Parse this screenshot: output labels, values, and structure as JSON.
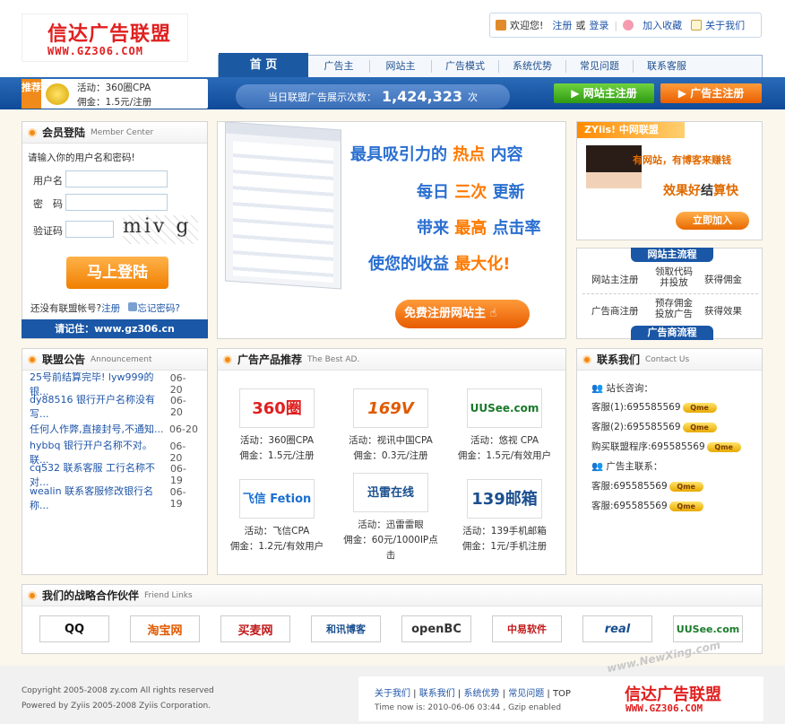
{
  "logo": {
    "cn": "信达广告联盟",
    "url": "WWW.GZ306.COM"
  },
  "toplinks": {
    "welcome": "欢迎您!",
    "register": "注册",
    "or": "或",
    "login": "登录",
    "favorite": "加入收藏",
    "about": "关于我们"
  },
  "nav": [
    "首 页",
    "广告主",
    "网站主",
    "广告模式",
    "系统优势",
    "常见问题",
    "联系客服"
  ],
  "tuijian": {
    "tag": "推荐",
    "activity": "活动：360圈CPA",
    "commission": "佣金：1.5元/注册"
  },
  "counter": {
    "label": "当日联盟广告展示次数：",
    "value": "1,424,323",
    "unit": "次"
  },
  "buttons": {
    "webmaster_register": "网站主注册",
    "advertiser_register": "广告主注册"
  },
  "login": {
    "title": "会员登陆",
    "en": "Member Center",
    "prompt": "请输入你的用户名和密码!",
    "username": "用户名",
    "password": "密　码",
    "captcha": "验证码",
    "captcha_img": "miv g",
    "submit": "马上登陆",
    "no_account": "还没有联盟帐号?",
    "register": "注册",
    "forgot": "忘记密码?",
    "remember": "请记住：www.gz306.cn"
  },
  "banner": {
    "line1a": "最具吸引力的",
    "line1b": "热点",
    "line1c": "内容",
    "line2a": "每日",
    "line2b": "三次",
    "line2c": "更新",
    "line3a": "带来",
    "line3b": "最高",
    "line3c": "点击率",
    "line4a": "使您的收益",
    "line4b": "最大化!",
    "cta": "免费注册网站主"
  },
  "zyiis": {
    "brand": "ZYiis! 中网联盟",
    "slogan1": "有网站，有博客来赚钱",
    "slogan2a": "效果好",
    "slogan2b": "结",
    "slogan2c": "算快",
    "join": "立即加入"
  },
  "flow": {
    "title1": "网站主流程",
    "w1": "网站主注册",
    "w2": "领取代码并投放",
    "w3": "获得佣金",
    "a1": "广告商注册",
    "a2": "预存佣金投放广告",
    "a3": "获得效果",
    "title2": "广告商流程"
  },
  "announce": {
    "title": "联盟公告",
    "en": "Announcement",
    "items": [
      {
        "text": "25号前结算完毕! lyw999的银...",
        "date": "06-20"
      },
      {
        "text": "dy88516 银行开户名称没有写...",
        "date": "06-20"
      },
      {
        "text": "任何人作弊,直接封号,不通知...",
        "date": "06-20"
      },
      {
        "text": "hybbq 银行开户名称不对。联...",
        "date": "06-20"
      },
      {
        "text": "cq532 联系客服 工行名称不对...",
        "date": "06-19"
      },
      {
        "text": "wealin 联系客服修改银行名称...",
        "date": "06-19"
      }
    ]
  },
  "products": {
    "title": "广告产品推荐",
    "en": "The Best AD.",
    "items": [
      {
        "logo": "360圈",
        "act": "活动：360圈CPA",
        "pay": "佣金：1.5元/注册"
      },
      {
        "logo": "169V",
        "act": "活动：视讯中国CPA",
        "pay": "佣金：0.3元/注册"
      },
      {
        "logo": "UUSee.com",
        "act": "活动：悠视 CPA",
        "pay": "佣金：1.5元/有效用户"
      },
      {
        "logo": "飞信 Fetion",
        "act": "活动：飞信CPA",
        "pay": "佣金：1.2元/有效用户"
      },
      {
        "logo": "迅雷在线",
        "act": "活动：迅雷雷眼",
        "pay": "佣金：60元/1000IP点击"
      },
      {
        "logo": "139邮箱",
        "act": "活动：139手机邮箱",
        "pay": "佣金：1元/手机注册"
      }
    ]
  },
  "contact": {
    "title": "联系我们",
    "en": "Contact Us",
    "head1": "站长咨询：",
    "s1": "客服(1):695585569",
    "s2": "客服(2):695585569",
    "s3": "购买联盟程序:695585569",
    "head2": "广告主联系：",
    "s4": "客服:695585569",
    "s5": "客服:695585569",
    "qm": "Qme"
  },
  "partners": {
    "title": "我们的战略合作伙伴",
    "en": "Friend Links",
    "items": [
      "QQ",
      "淘宝网",
      "买麦网",
      "和讯博客",
      "openBC",
      "中易软件",
      "real",
      "UUSee.com"
    ]
  },
  "footer": {
    "copy1": "Copyright 2005-2008 zy.com All rights reserved",
    "copy2": "Powered by Zyiis 2005-2008 Zyiis Corporation.",
    "links": [
      "关于我们",
      "联系我们",
      "系统优势",
      "常见问题",
      "TOP"
    ],
    "time": "Time now is: 2010-06-06 03:44 , Gzip enabled",
    "watermark": "www.NewXing.com"
  }
}
